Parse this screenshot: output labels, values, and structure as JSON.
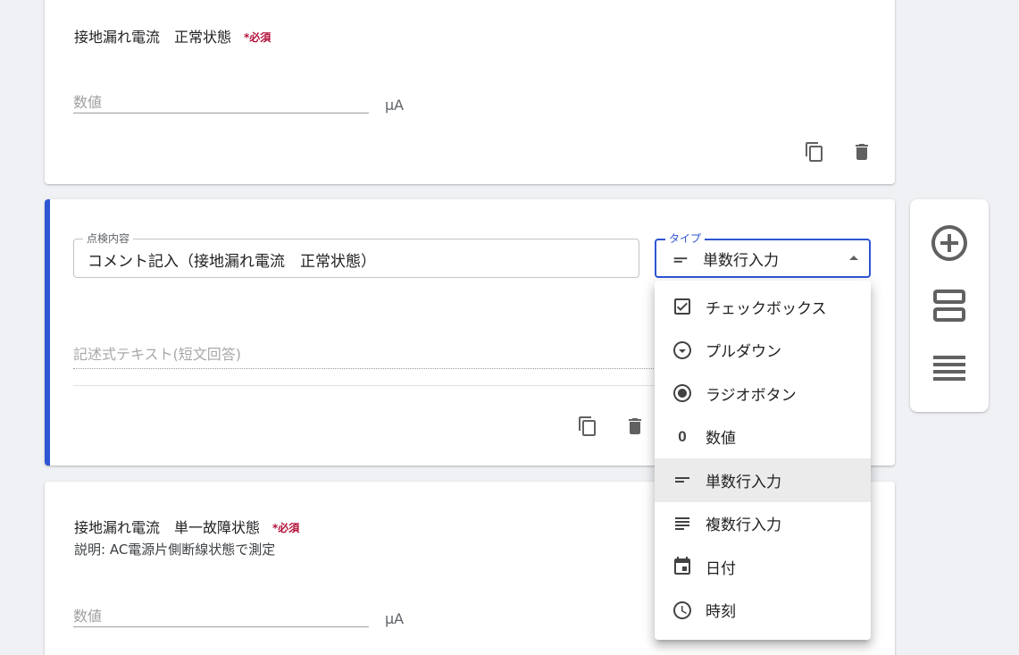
{
  "card1": {
    "title": "接地漏れ電流　正常状態",
    "required": "*必須",
    "number_placeholder": "数値",
    "unit": "μA"
  },
  "card2": {
    "content_label": "点検内容",
    "content_value": "コメント記入（接地漏れ電流　正常状態）",
    "type_label": "タイプ",
    "type_value": "単数行入力",
    "answer_placeholder": "記述式テキスト(短文回答)"
  },
  "card3": {
    "title": "接地漏れ電流　単一故障状態",
    "required": "*必須",
    "description": "説明: AC電源片側断線状態で測定",
    "number_placeholder": "数値",
    "unit": "μA"
  },
  "type_menu": {
    "items": [
      {
        "label": "チェックボックス",
        "icon": "checkbox-icon"
      },
      {
        "label": "プルダウン",
        "icon": "dropdown-circle-icon"
      },
      {
        "label": "ラジオボタン",
        "icon": "radio-button-icon"
      },
      {
        "label": "数値",
        "icon": "number-zero-icon",
        "glyph": "0"
      },
      {
        "label": "単数行入力",
        "icon": "short-text-icon",
        "selected": true
      },
      {
        "label": "複数行入力",
        "icon": "multi-line-icon"
      },
      {
        "label": "日付",
        "icon": "calendar-icon"
      },
      {
        "label": "時刻",
        "icon": "clock-icon"
      }
    ]
  },
  "side_toolbar": {
    "buttons": [
      "add-question-icon",
      "add-section-icon",
      "reorder-icon"
    ]
  },
  "colors": {
    "accent": "#2f55d4",
    "required": "#b3123b",
    "background": "#f0f1f4"
  }
}
